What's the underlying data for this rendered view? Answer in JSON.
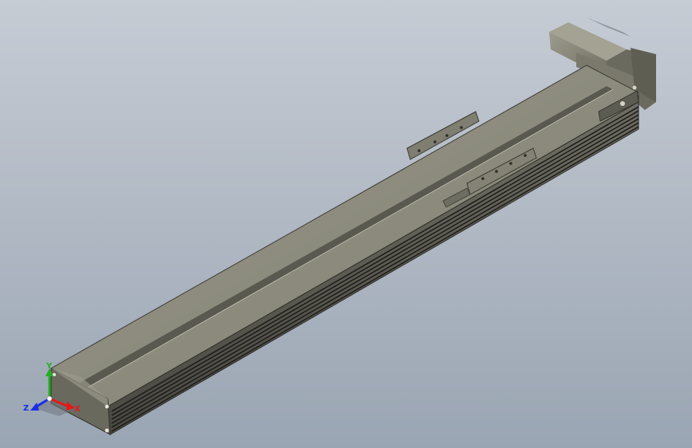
{
  "viewport": {
    "background_top": "#c6ccd4",
    "background_bottom": "#9aa5b3"
  },
  "model": {
    "body_color": "#8c8b7c",
    "body_dark": "#5d5c52",
    "body_light": "#a9a898",
    "rail_color": "#2b2b28",
    "motor_color": "#8a897b"
  },
  "triad": {
    "x_label": "X",
    "y_label": "Y",
    "z_label": "Z",
    "x_color": "#e01a1a",
    "y_color": "#22b022",
    "z_color": "#1a2ee6",
    "origin_color": "#ffffff"
  }
}
